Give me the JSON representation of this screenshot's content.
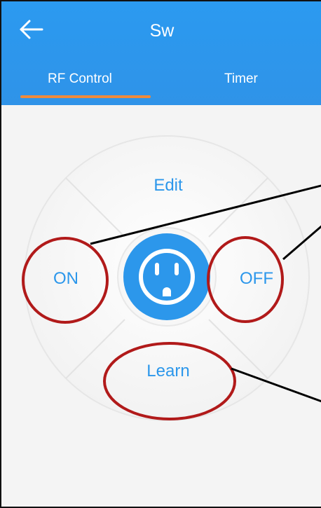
{
  "header": {
    "title": "Sw",
    "back_icon": "arrow-left-icon"
  },
  "tabs": [
    {
      "label": "RF Control",
      "active": true
    },
    {
      "label": "Timer",
      "active": false
    }
  ],
  "remote": {
    "edit_label": "Edit",
    "on_label": "ON",
    "off_label": "OFF",
    "learn_label": "Learn",
    "center_icon": "power-outlet-icon"
  },
  "colors": {
    "header_bg": "#2f93e8",
    "accent_text": "#2c97eb",
    "tab_indicator": "#ef8a3b",
    "annotation_circle": "#b11a1a",
    "annotation_line": "#000000"
  }
}
